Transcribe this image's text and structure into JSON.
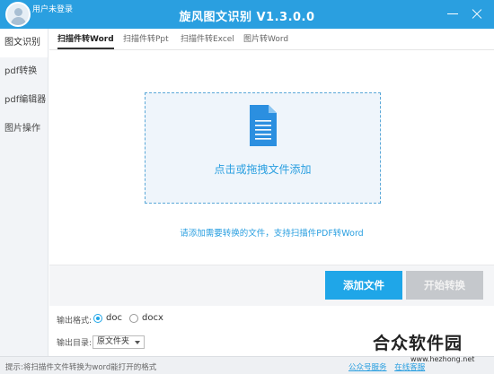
{
  "titlebar": {
    "user_status": "用户未登录",
    "title": "旋风图文识别 V1.3.0.0"
  },
  "sidebar": {
    "items": [
      {
        "label": "图文识别",
        "active": true
      },
      {
        "label": "pdf转换",
        "active": false
      },
      {
        "label": "pdf编辑器",
        "active": false
      },
      {
        "label": "图片操作",
        "active": false
      }
    ]
  },
  "tabs": [
    {
      "label": "扫描件转Word",
      "active": true
    },
    {
      "label": "扫描件转Ppt",
      "active": false
    },
    {
      "label": "扫描件转Excel",
      "active": false
    },
    {
      "label": "图片转Word",
      "active": false
    }
  ],
  "dropzone": {
    "icon": "document-icon",
    "text": "点击或拖拽文件添加"
  },
  "hint": "请添加需要转换的文件，支持扫描件PDF转Word",
  "buttons": {
    "add": "添加文件",
    "start": "开始转换"
  },
  "format": {
    "label": "输出格式:",
    "options": [
      "doc",
      "docx"
    ],
    "selected": "doc"
  },
  "output_dir": {
    "label": "输出目录:",
    "value": "原文件夹"
  },
  "statusbar": {
    "tip": "提示:将扫描件文件转换为word能打开的格式",
    "links": [
      "公众号服务",
      "在线客服"
    ]
  },
  "watermark": {
    "main": "合众软件园",
    "url": "www.hezhong.net"
  },
  "colors": {
    "accent": "#2a9fe0",
    "button_primary": "#1fa6e8",
    "button_disabled": "#c5c8cc"
  }
}
